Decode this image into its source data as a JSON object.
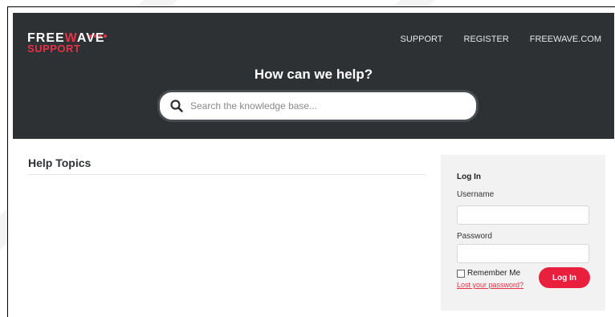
{
  "logo": {
    "brand_prefix": "FREE",
    "brand_accent": "W",
    "brand_suffix": "AVE",
    "sub": "SUPPORT",
    "accent_color": "#e53248"
  },
  "nav": {
    "items": [
      "SUPPORT",
      "REGISTER",
      "FREEWAVE.COM"
    ]
  },
  "hero": {
    "title": "How can we help?"
  },
  "search": {
    "placeholder": "Search the knowledge base...",
    "icon": "search-icon"
  },
  "topics": {
    "title": "Help Topics"
  },
  "login": {
    "title": "Log In",
    "username_label": "Username",
    "password_label": "Password",
    "remember_label": "Remember Me",
    "lost_password": "Lost your password?",
    "button_label": "Log In",
    "button_color": "#e8203e"
  },
  "colors": {
    "header_bg": "#2e3133",
    "panel_bg": "#f2f2f2"
  }
}
